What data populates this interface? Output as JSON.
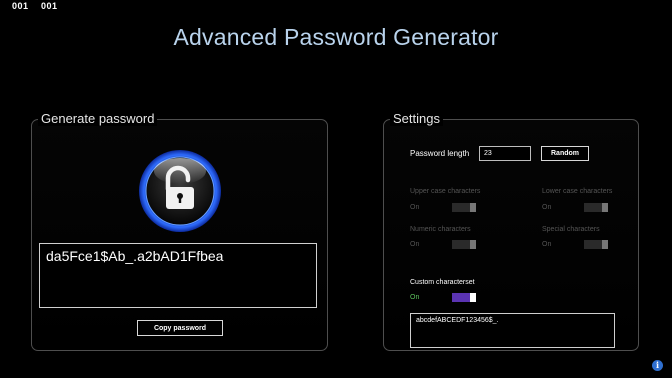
{
  "counters": [
    "001",
    "001"
  ],
  "app_title": "Advanced Password Generator",
  "generate": {
    "title": "Generate password",
    "password": "da5Fce1$Ab_.a2bAD1Ffbea",
    "copy_label": "Copy password",
    "lock_icon": "lock-open-icon"
  },
  "settings": {
    "title": "Settings",
    "length_label": "Password length",
    "length_value": "23",
    "random_label": "Random",
    "upper": {
      "label": "Upper case characters",
      "state": "On"
    },
    "lower": {
      "label": "Lower case characters",
      "state": "On"
    },
    "numeric": {
      "label": "Numeric characters",
      "state": "On"
    },
    "special": {
      "label": "Special characters",
      "state": "On"
    },
    "custom": {
      "label": "Custom characterset",
      "state": "On",
      "value": "abcdefABCEDF123456$_."
    }
  },
  "colors": {
    "title": "#b9d3ec",
    "toggle_active": "#5b34b3",
    "on_green": "#5ec45e"
  },
  "info_icon": "info-icon"
}
